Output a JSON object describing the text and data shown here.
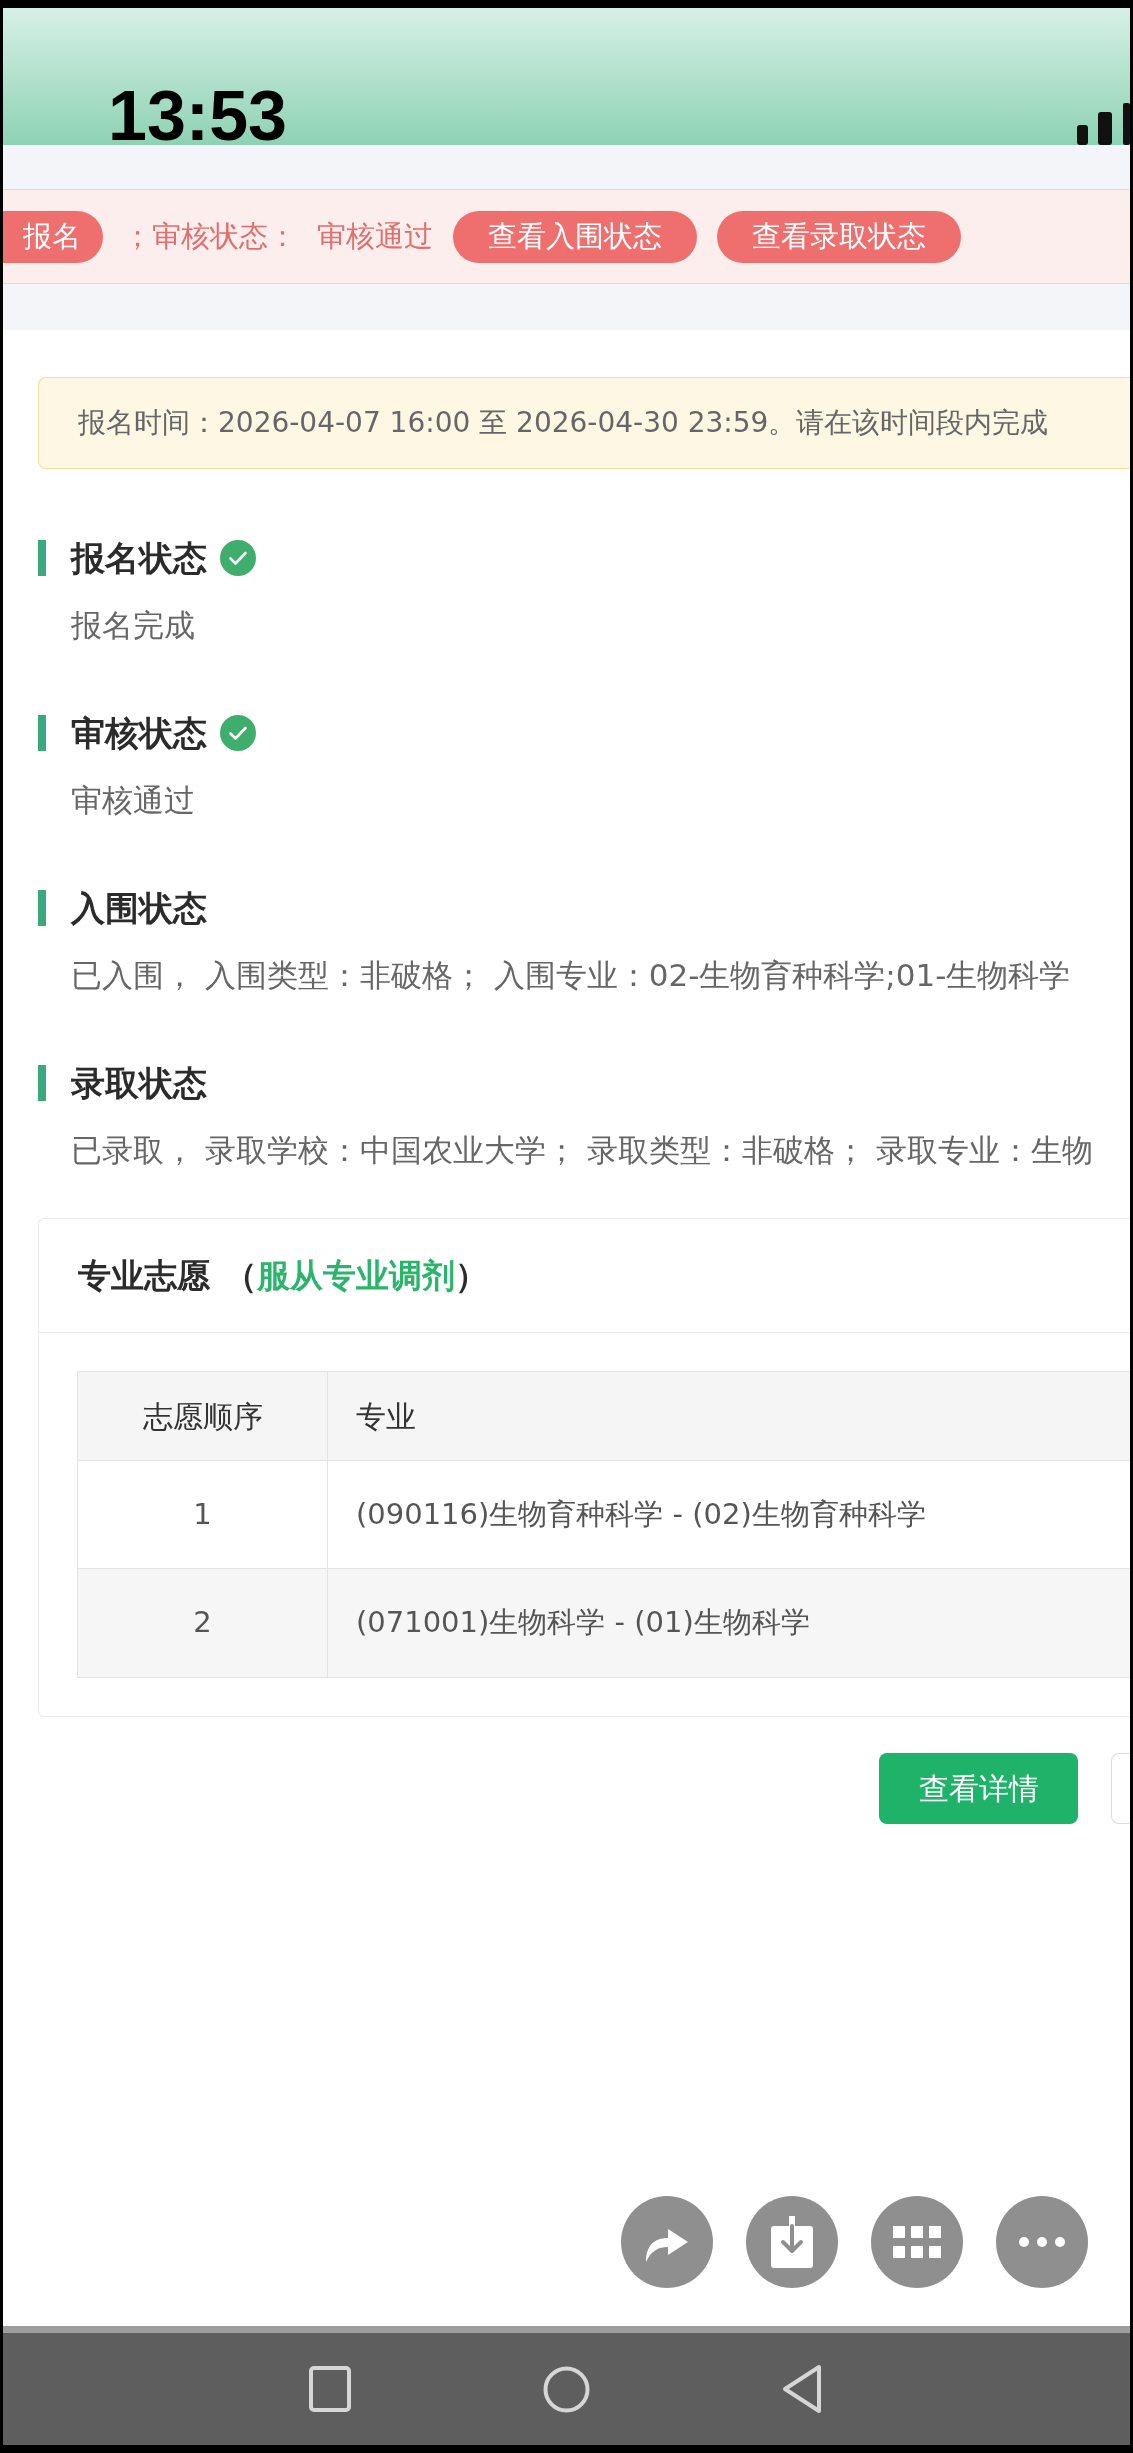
{
  "status_bar": {
    "time": "13:53"
  },
  "banner": {
    "items": [
      {
        "kind": "tag",
        "text": "报名"
      },
      {
        "kind": "text",
        "text": "；审核状态："
      },
      {
        "kind": "text",
        "text": "审核通过"
      },
      {
        "kind": "pill",
        "text": "查看入围状态"
      },
      {
        "kind": "pill",
        "text": "查看录取状态"
      }
    ]
  },
  "notice": {
    "text": "报名时间：2026-04-07 16:00 至 2026-04-30 23:59。请在该时间段内完成"
  },
  "sections": [
    {
      "title": "报名状态",
      "done": true,
      "value": "报名完成"
    },
    {
      "title": "审核状态",
      "done": true,
      "value": "审核通过"
    },
    {
      "title": "入围状态",
      "done": false,
      "value": "已入围， 入围类型：非破格； 入围专业：02-生物育种科学;01-生物科学"
    },
    {
      "title": "录取状态",
      "done": false,
      "value": "已录取， 录取学校：中国农业大学； 录取类型：非破格； 录取专业：生物"
    }
  ],
  "preferences": {
    "title": "专业志愿",
    "note_open": "（",
    "note": "服从专业调剂",
    "note_close": "）",
    "table": {
      "columns": [
        "志愿顺序",
        "专业"
      ],
      "rows": [
        [
          "1",
          "(090116)生物育种科学 - (02)生物育种科学"
        ],
        [
          "2",
          "(071001)生物科学 - (01)生物科学"
        ]
      ]
    }
  },
  "buttons": [
    {
      "kind": "primary",
      "label": "查看详情"
    },
    {
      "kind": "outline"
    }
  ]
}
